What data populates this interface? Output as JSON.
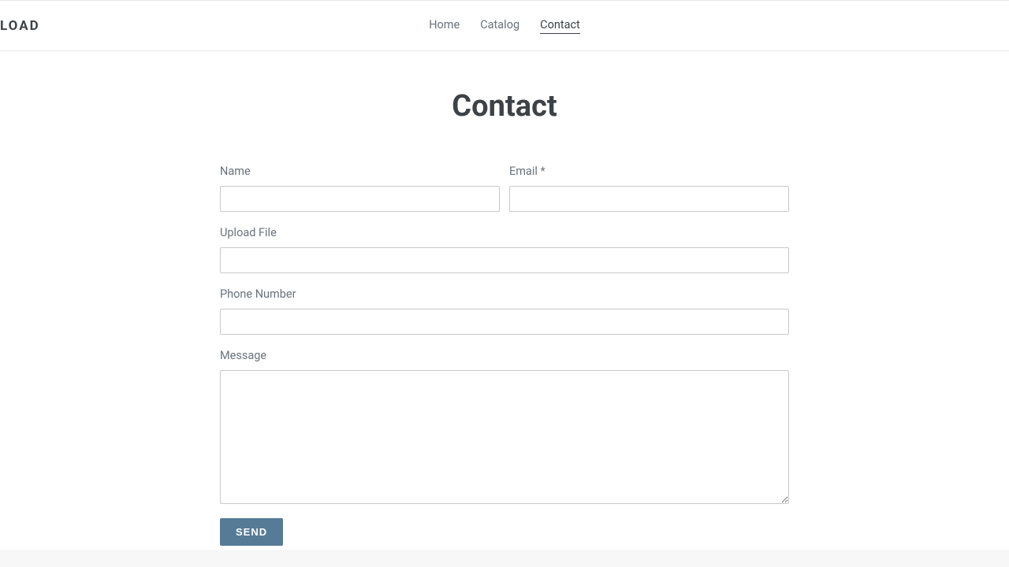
{
  "logo": "LOAD",
  "nav": {
    "home": "Home",
    "catalog": "Catalog",
    "contact": "Contact"
  },
  "page": {
    "title": "Contact"
  },
  "form": {
    "name_label": "Name",
    "email_label": "Email *",
    "upload_label": "Upload File",
    "phone_label": "Phone Number",
    "message_label": "Message",
    "name_value": "",
    "email_value": "",
    "upload_value": "",
    "phone_value": "",
    "message_value": "",
    "send_label": "SEND"
  }
}
